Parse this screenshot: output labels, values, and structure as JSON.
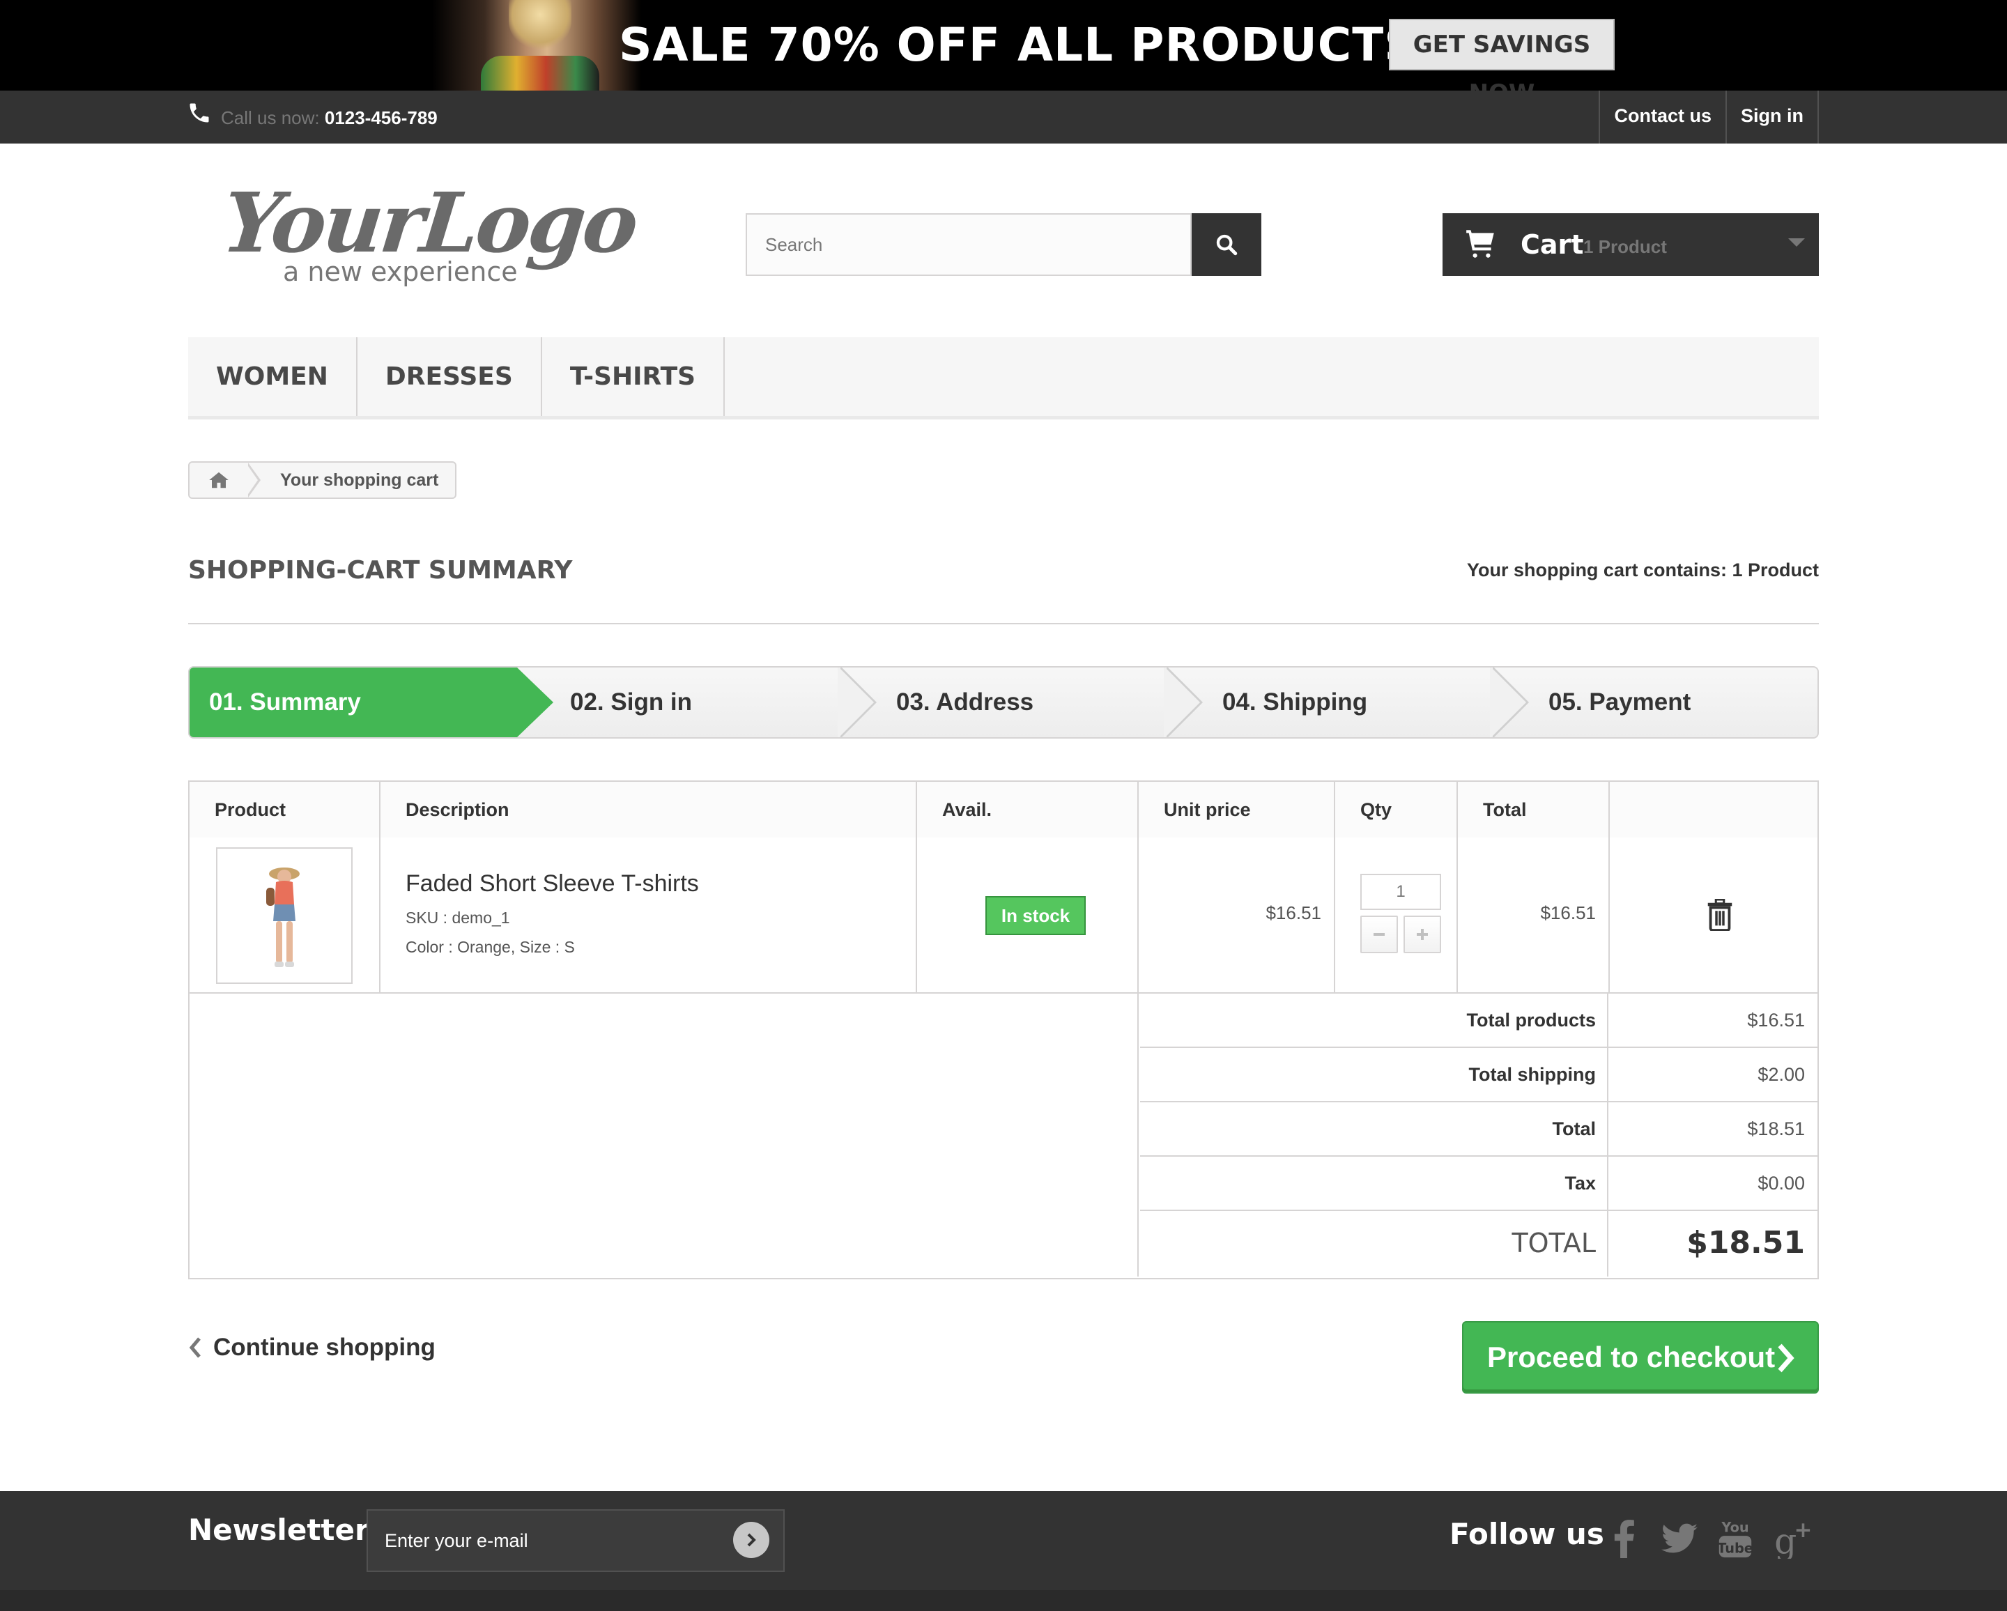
{
  "banner": {
    "headline": "SALE 70% OFF ALL PRODUCTS",
    "cta": "GET SAVINGS NOW"
  },
  "top_nav": {
    "call_label": "Call us now: ",
    "phone": "0123-456-789",
    "links": [
      "Contact us",
      "Sign in"
    ]
  },
  "logo": {
    "main": "YourLogo",
    "tagline": "a new experience"
  },
  "search": {
    "placeholder": "Search",
    "value": "",
    "icon": "search-icon"
  },
  "cart": {
    "label": "Cart",
    "quantity": "1 Product",
    "icon": "cart-icon"
  },
  "menu": {
    "items": [
      "WOMEN",
      "DRESSES",
      "T-SHIRTS"
    ]
  },
  "breadcrumb": {
    "home_icon": "home-icon",
    "current": "Your shopping cart"
  },
  "page": {
    "heading": "SHOPPING-CART SUMMARY",
    "cart_count": "Your shopping cart contains: 1 Product"
  },
  "steps": [
    "01. Summary",
    "02. Sign in",
    "03. Address",
    "04. Shipping",
    "05. Payment"
  ],
  "table": {
    "headers": [
      "Product",
      "Description",
      "Avail.",
      "Unit price",
      "Qty",
      "Total",
      ""
    ],
    "rows": [
      {
        "name": "Faded Short Sleeve T-shirts",
        "sku": "SKU : demo_1",
        "attributes": "Color : Orange, Size : S",
        "availability": "In stock",
        "unit_price": "$16.51",
        "qty": "1",
        "total": "$16.51"
      }
    ],
    "summary": [
      {
        "label": "Total products",
        "value": "$16.51"
      },
      {
        "label": "Total shipping",
        "value": "$2.00"
      },
      {
        "label": "Total",
        "value": "$18.51"
      },
      {
        "label": "Tax",
        "value": "$0.00"
      },
      {
        "label": "TOTAL",
        "value": "$18.51"
      }
    ]
  },
  "actions": {
    "continue": "Continue shopping",
    "checkout": "Proceed to checkout"
  },
  "footer": {
    "newsletter_title": "Newsletter",
    "newsletter_placeholder": "Enter your e-mail",
    "follow_title": "Follow us",
    "social": [
      "facebook-icon",
      "twitter-icon",
      "youtube-icon",
      "google-plus-icon"
    ]
  },
  "colors": {
    "accent_green": "#43b754",
    "dark_bar": "#333333",
    "border": "#d6d4d4"
  }
}
